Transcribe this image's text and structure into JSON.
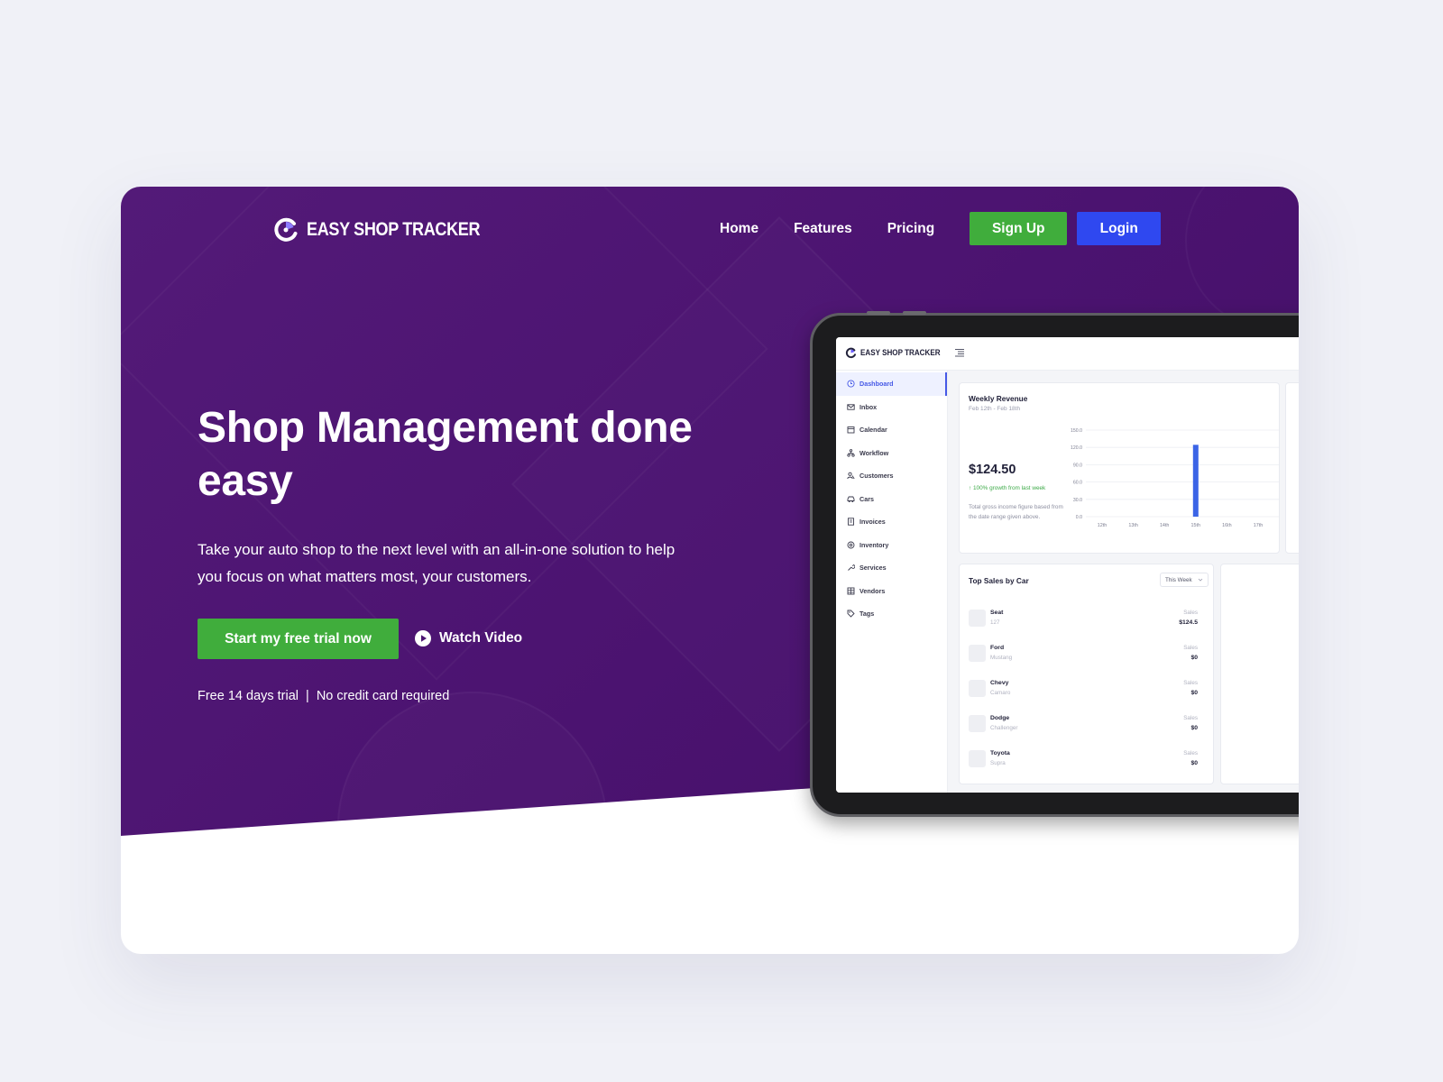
{
  "brand": {
    "name": "EASY SHOP TRACKER",
    "accent": "#40ad3c",
    "primary": "#2f48f0",
    "hero_bg": "#4b1370"
  },
  "nav": {
    "links": [
      "Home",
      "Features",
      "Pricing"
    ],
    "signup_label": "Sign Up",
    "login_label": "Login"
  },
  "hero": {
    "title": "Shop Management done easy",
    "subtitle": "Take your auto shop to the next level with an all-in-one solution to help you focus on what matters most, your customers.",
    "cta_label": "Start my free trial now",
    "video_label": "Watch Video",
    "note_left": "Free 14 days trial",
    "note_sep": "|",
    "note_right": "No credit card required"
  },
  "dashboard": {
    "app_name": "EASY SHOP TRACKER",
    "sidebar": [
      {
        "label": "Dashboard",
        "icon": "clock-icon",
        "active": true
      },
      {
        "label": "Inbox",
        "icon": "mail-icon"
      },
      {
        "label": "Calendar",
        "icon": "calendar-icon"
      },
      {
        "label": "Workflow",
        "icon": "workflow-icon"
      },
      {
        "label": "Customers",
        "icon": "customers-icon"
      },
      {
        "label": "Cars",
        "icon": "car-icon"
      },
      {
        "label": "Invoices",
        "icon": "invoice-icon"
      },
      {
        "label": "Inventory",
        "icon": "inventory-icon"
      },
      {
        "label": "Services",
        "icon": "wrench-icon"
      },
      {
        "label": "Vendors",
        "icon": "vendors-icon"
      },
      {
        "label": "Tags",
        "icon": "tag-icon"
      }
    ],
    "revenue": {
      "title": "Weekly Revenue",
      "range": "Feb 12th - Feb 18th",
      "amount": "$124.50",
      "growth": "↑ 100% growth from last week",
      "description": "Total gross income figure based from the date range given above."
    },
    "top_sales": {
      "title": "Top Sales by Car",
      "period": "This Week",
      "rows": [
        {
          "make": "Seat",
          "model": "127",
          "label": "Sales",
          "value": "$124.5"
        },
        {
          "make": "Ford",
          "model": "Mustang",
          "label": "Sales",
          "value": "$0"
        },
        {
          "make": "Chevy",
          "model": "Camaro",
          "label": "Sales",
          "value": "$0"
        },
        {
          "make": "Dodge",
          "model": "Challenger",
          "label": "Sales",
          "value": "$0"
        },
        {
          "make": "Toyota",
          "model": "Supra",
          "label": "Sales",
          "value": "$0"
        }
      ]
    }
  },
  "chart_data": {
    "type": "bar",
    "categories": [
      "12th",
      "13th",
      "14th",
      "15th",
      "16th",
      "17th"
    ],
    "values": [
      0,
      0,
      0,
      124.5,
      0,
      0
    ],
    "y_ticks": [
      "0.0",
      "30.0",
      "60.0",
      "90.0",
      "120.0",
      "150.0"
    ],
    "ylim": [
      0,
      150
    ],
    "grid": true,
    "bar_color": "#3b64e6"
  }
}
